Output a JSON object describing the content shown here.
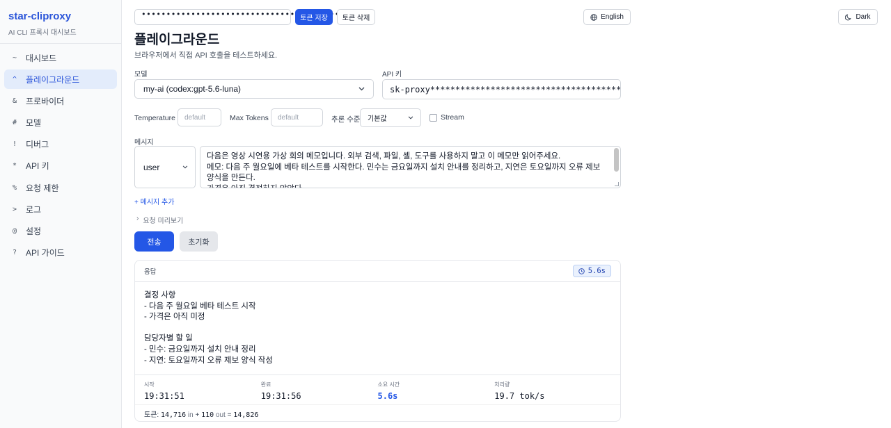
{
  "app": {
    "name": "star-cliproxy",
    "subtitle": "AI CLI 프록시 대시보드"
  },
  "sidebar": {
    "items": [
      {
        "glyph": "~",
        "label": "대시보드",
        "active": false
      },
      {
        "glyph": "^",
        "label": "플레이그라운드",
        "active": true
      },
      {
        "glyph": "&",
        "label": "프로바이더",
        "active": false
      },
      {
        "glyph": "#",
        "label": "모델",
        "active": false
      },
      {
        "glyph": "!",
        "label": "디버그",
        "active": false
      },
      {
        "glyph": "*",
        "label": "API 키",
        "active": false
      },
      {
        "glyph": "%",
        "label": "요청 제한",
        "active": false
      },
      {
        "glyph": ">",
        "label": "로그",
        "active": false
      },
      {
        "glyph": "@",
        "label": "설정",
        "active": false
      },
      {
        "glyph": "?",
        "label": "API 가이드",
        "active": false
      }
    ]
  },
  "topbar": {
    "token_value": "••••••••••••••••••••••••••••••••••••••••••••",
    "save_label": "토큰 저장",
    "delete_label": "토큰 삭제",
    "language_label": "English",
    "theme_label": "Dark"
  },
  "page": {
    "title": "플레이그라운드",
    "description": "브라우저에서 직접 API 호출을 테스트하세요."
  },
  "form": {
    "model_label": "모델",
    "model_value": "my-ai (codex:gpt-5.6-luna)",
    "apikey_label": "API 키",
    "apikey_value": "sk-proxy****************************************",
    "temperature_label": "Temperature",
    "temperature_placeholder": "default",
    "max_tokens_label": "Max Tokens",
    "max_tokens_placeholder": "default",
    "reasoning_label": "추론 수준",
    "reasoning_value": "기본값",
    "stream_label": "Stream",
    "stream_checked": false,
    "messages_label": "메시지",
    "role_value": "user",
    "message_text": "다음은 영상 시연용 가상 회의 메모입니다. 외부 검색, 파일, 셸, 도구를 사용하지 말고 이 메모만 읽어주세요.\n메모: 다음 주 월요일에 베타 테스트를 시작한다. 민수는 금요일까지 설치 안내를 정리하고, 지연은 토요일까지 오류 제보 양식을 만든다.\n가격은 아직 결정하지 않았다.\n결정 사항과 담당자별 할 일을 간결하게 정리해주세요.",
    "add_message_label": "+ 메시지 추가",
    "preview_label": "요청 미리보기",
    "send_label": "전송",
    "reset_label": "초기화"
  },
  "response": {
    "title": "응답",
    "elapsed_badge": "5.6s",
    "body": "결정 사항\n- 다음 주 월요일 베타 테스트 시작\n- 가격은 아직 미정\n\n담당자별 할 일\n- 민수: 금요일까지 설치 안내 정리\n- 지연: 토요일까지 오류 제보 양식 작성",
    "stats": [
      {
        "key": "시작",
        "value": "19:31:51",
        "accent": false
      },
      {
        "key": "완료",
        "value": "19:31:56",
        "accent": false
      },
      {
        "key": "소요 시간",
        "value": "5.6s",
        "accent": true
      },
      {
        "key": "처리량",
        "value": "19.7 tok/s",
        "accent": false
      }
    ],
    "tokens": {
      "prefix": "토큰:",
      "in_value": "14,716",
      "in_label": "in",
      "plus": "+",
      "out_value": "110",
      "out_label": "out",
      "equals": "=",
      "total": "14,826"
    }
  },
  "colors": {
    "accent": "#2457e6",
    "active_bg": "#e3ecfb",
    "sidebar_bg": "#f9fafb"
  }
}
